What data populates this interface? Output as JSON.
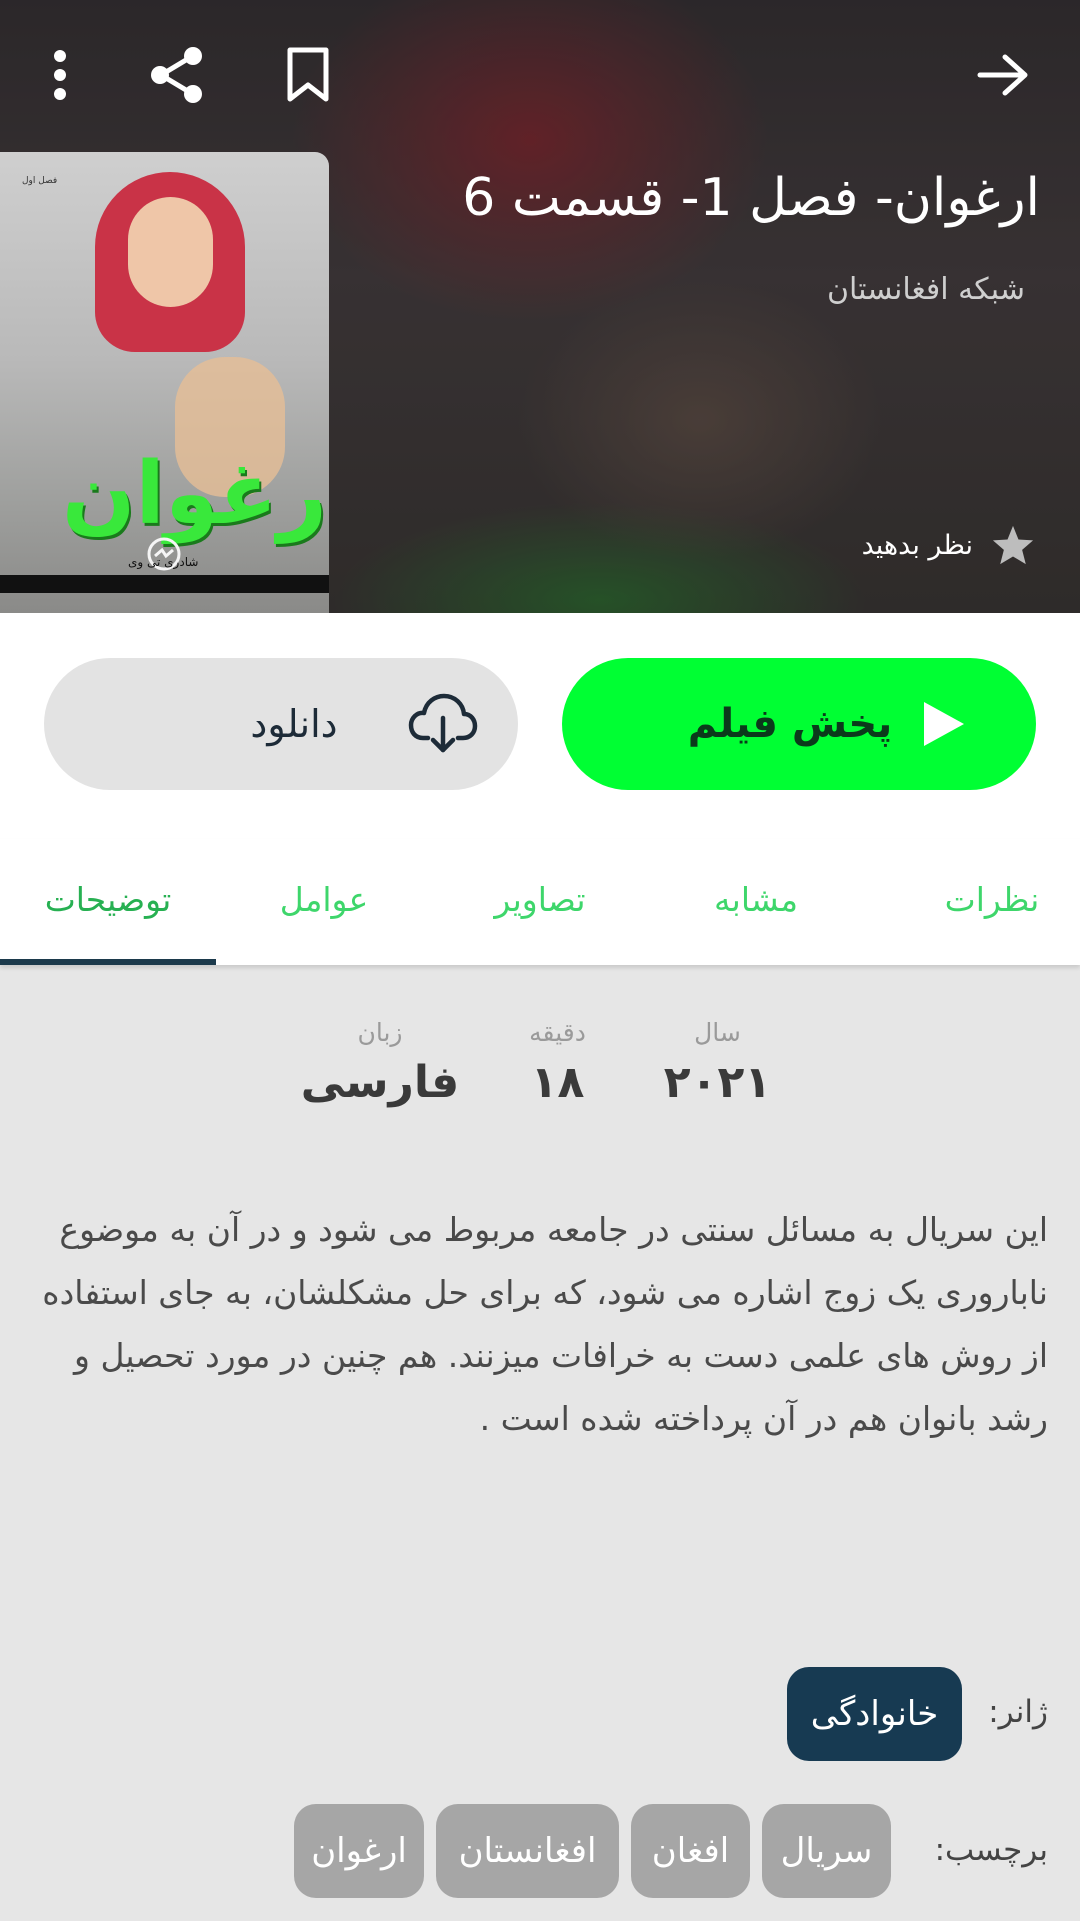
{
  "header": {
    "title": "ارغوان- فصل 1- قسمت 6",
    "channel": "شبکه افغانستان",
    "rate_label": "نظر بدهید"
  },
  "poster": {
    "title": "ارغوان",
    "channel_mark": "شادری تی وی"
  },
  "actions": {
    "play_label": "پخش فیلم",
    "download_label": "دانلود"
  },
  "tabs": [
    {
      "label": "نظرات"
    },
    {
      "label": "مشابه"
    },
    {
      "label": "تصاویر"
    },
    {
      "label": "عوامل"
    },
    {
      "label": "توضیحات",
      "active": true
    }
  ],
  "stats": [
    {
      "label": "سال",
      "value": "۲۰۲۱"
    },
    {
      "label": "دقیقه",
      "value": "۱۸"
    },
    {
      "label": "زبان",
      "value": "فارسی"
    }
  ],
  "description": "این سریال به مسائل سنتی در جامعه مربوط می شود و در آن به موضوع ناباروری یک زوج اشاره می شود، که برای حل مشکلشان، به جای استفاده از روش های علمی دست به خرافات میزنند. هم چنین در مورد تحصیل و رشد بانوان هم در آن پرداخته شده است .",
  "genre": {
    "label": "ژانر:",
    "value": "خانوادگی"
  },
  "tags": {
    "label": "برچسب:",
    "items": [
      "سریال",
      "افغان",
      "افغانستان",
      "ارغوان"
    ]
  },
  "colors": {
    "play_button": "#00ff33",
    "tab_text": "#3ed66b",
    "tab_indicator": "#1c3a4c",
    "genre_chip": "#173a52",
    "tag_chip": "#a6a6a6"
  }
}
